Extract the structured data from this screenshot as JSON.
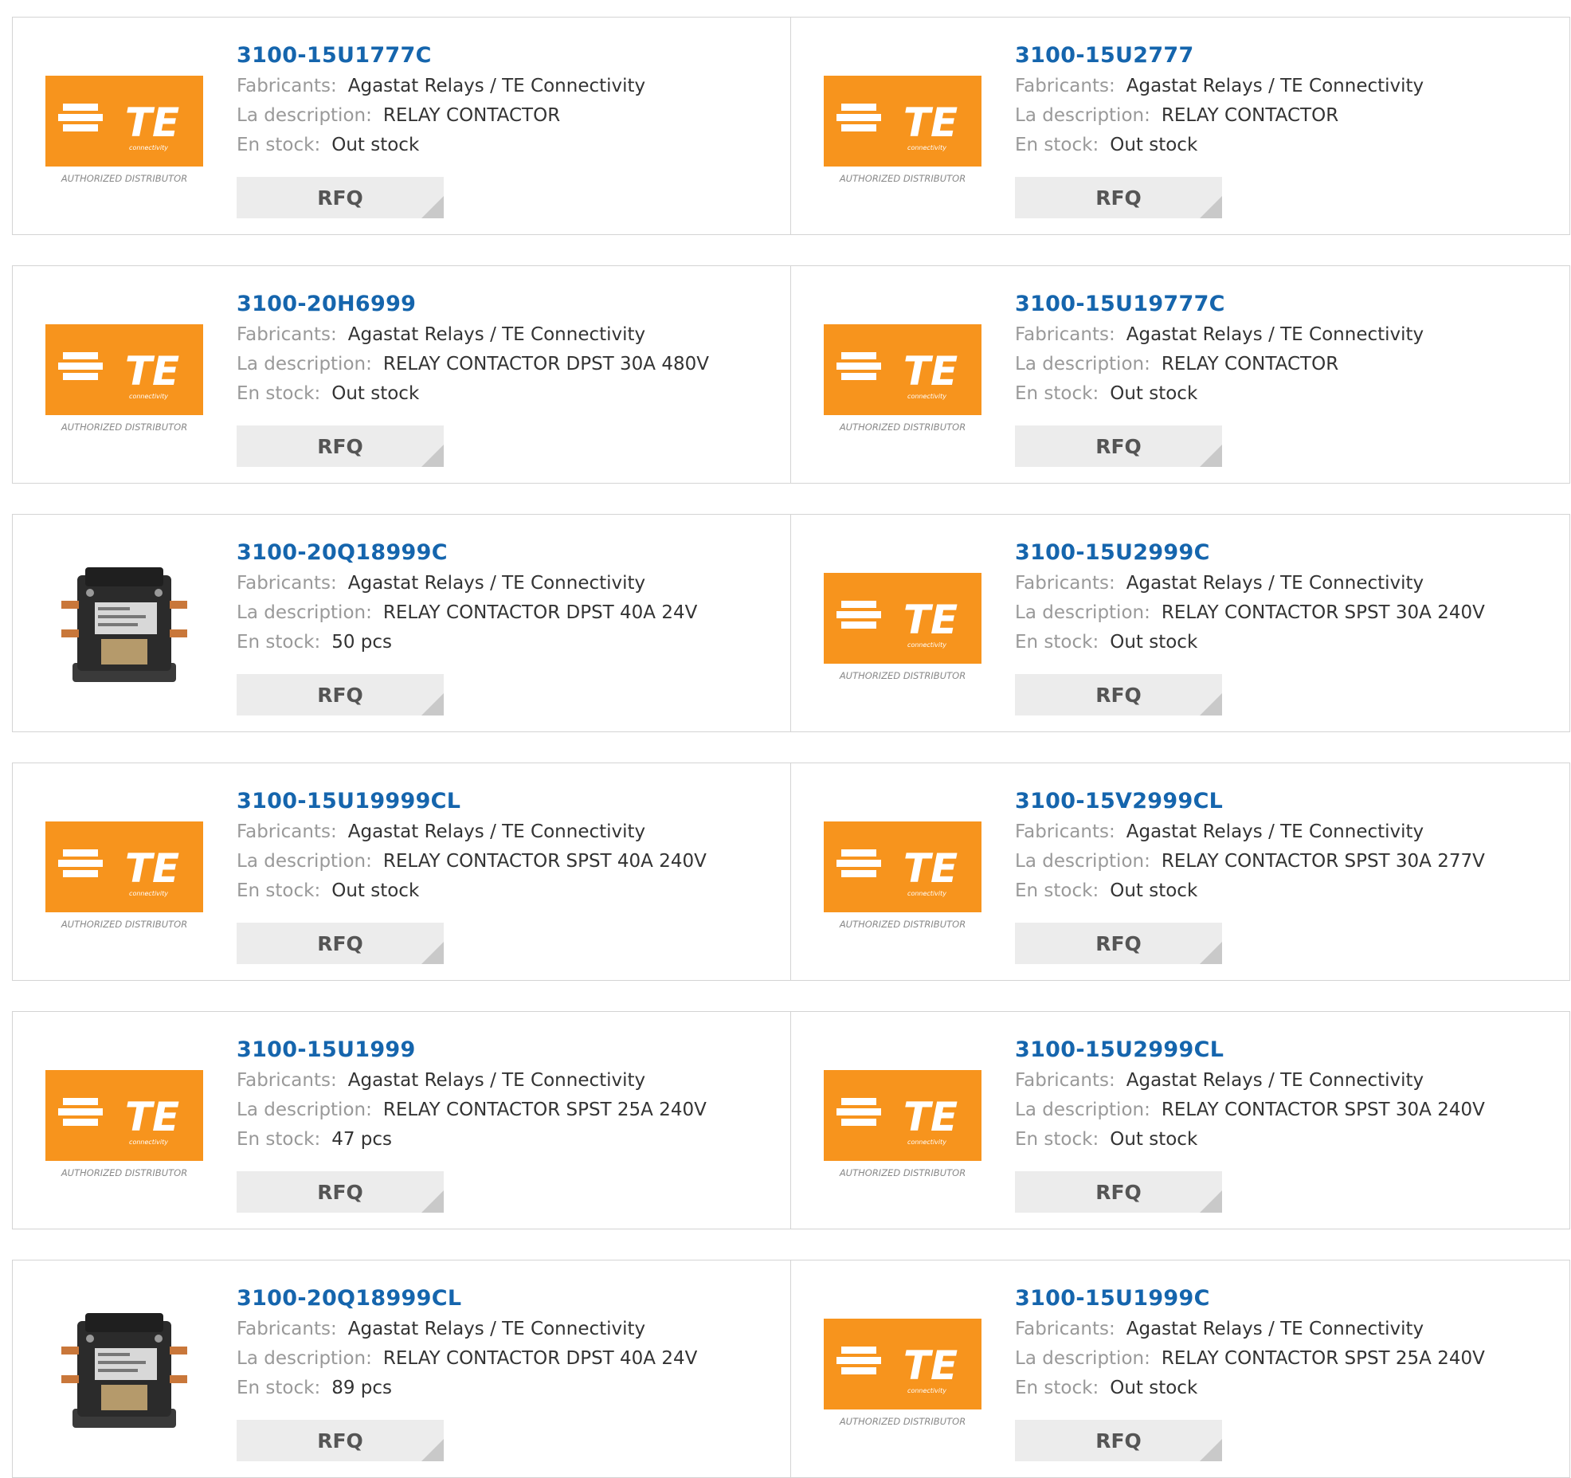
{
  "labels": {
    "manufacturer": "Fabricants",
    "description": "La description",
    "stock": "En stock",
    "separator": ":",
    "rfq": "RFQ"
  },
  "logo": {
    "mark": "TE",
    "sub": "connectivity",
    "tagline": "AUTHORIZED DISTRIBUTOR",
    "brand_color": "#f7941d"
  },
  "products": [
    {
      "part": "3100-15U1777C",
      "manufacturer": "Agastat Relays / TE Connectivity",
      "description": "RELAY CONTACTOR",
      "stock": "Out stock",
      "image": "te-logo"
    },
    {
      "part": "3100-15U2777",
      "manufacturer": "Agastat Relays / TE Connectivity",
      "description": "RELAY CONTACTOR",
      "stock": "Out stock",
      "image": "te-logo"
    },
    {
      "part": "3100-20H6999",
      "manufacturer": "Agastat Relays / TE Connectivity",
      "description": "RELAY CONTACTOR DPST 30A 480V",
      "stock": "Out stock",
      "image": "te-logo"
    },
    {
      "part": "3100-15U19777C",
      "manufacturer": "Agastat Relays / TE Connectivity",
      "description": "RELAY CONTACTOR",
      "stock": "Out stock",
      "image": "te-logo"
    },
    {
      "part": "3100-20Q18999C",
      "manufacturer": "Agastat Relays / TE Connectivity",
      "description": "RELAY CONTACTOR DPST 40A 24V",
      "stock": "50 pcs",
      "image": "contactor-photo"
    },
    {
      "part": "3100-15U2999C",
      "manufacturer": "Agastat Relays / TE Connectivity",
      "description": "RELAY CONTACTOR SPST 30A 240V",
      "stock": "Out stock",
      "image": "te-logo"
    },
    {
      "part": "3100-15U19999CL",
      "manufacturer": "Agastat Relays / TE Connectivity",
      "description": "RELAY CONTACTOR SPST 40A 240V",
      "stock": "Out stock",
      "image": "te-logo"
    },
    {
      "part": "3100-15V2999CL",
      "manufacturer": "Agastat Relays / TE Connectivity",
      "description": "RELAY CONTACTOR SPST 30A 277V",
      "stock": "Out stock",
      "image": "te-logo"
    },
    {
      "part": "3100-15U1999",
      "manufacturer": "Agastat Relays / TE Connectivity",
      "description": "RELAY CONTACTOR SPST 25A 240V",
      "stock": "47 pcs",
      "image": "te-logo"
    },
    {
      "part": "3100-15U2999CL",
      "manufacturer": "Agastat Relays / TE Connectivity",
      "description": "RELAY CONTACTOR SPST 30A 240V",
      "stock": "Out stock",
      "image": "te-logo"
    },
    {
      "part": "3100-20Q18999CL",
      "manufacturer": "Agastat Relays / TE Connectivity",
      "description": "RELAY CONTACTOR DPST 40A 24V",
      "stock": "89 pcs",
      "image": "contactor-photo"
    },
    {
      "part": "3100-15U1999C",
      "manufacturer": "Agastat Relays / TE Connectivity",
      "description": "RELAY CONTACTOR SPST 25A 240V",
      "stock": "Out stock",
      "image": "te-logo"
    }
  ]
}
